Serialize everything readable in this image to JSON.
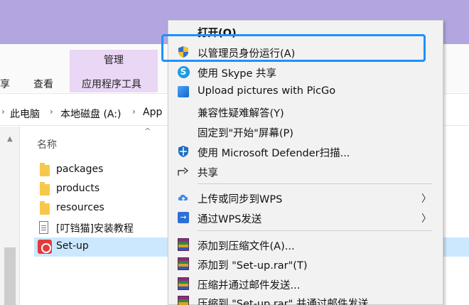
{
  "explorer": {
    "ribbon": {
      "tabs": [
        "享",
        "查看"
      ],
      "contextual_group": "管理",
      "contextual_tab": "应用程序工具"
    },
    "breadcrumb": [
      "此电脑",
      "本地磁盘 (A:)",
      "App"
    ],
    "column_header": "名称",
    "files": [
      {
        "name": "packages",
        "icon": "folder-icon"
      },
      {
        "name": "products",
        "icon": "folder-icon"
      },
      {
        "name": "resources",
        "icon": "folder-icon"
      },
      {
        "name": "[叮铛猫]安装教程",
        "icon": "document-icon"
      },
      {
        "name": "Set-up",
        "icon": "setup-exe-icon",
        "selected": true
      }
    ]
  },
  "context_menu": {
    "items": [
      {
        "label": "打开(O)",
        "bold": true,
        "icon": ""
      },
      {
        "label": "以管理员身份运行(A)",
        "icon": "uac-shield-icon",
        "highlighted": true
      },
      {
        "label": "使用 Skype 共享",
        "icon": "skype-icon"
      },
      {
        "label": "Upload pictures with PicGo",
        "icon": "picgo-icon"
      },
      {
        "label": "兼容性疑难解答(Y)",
        "icon": ""
      },
      {
        "label": "固定到\"开始\"屏幕(P)",
        "icon": ""
      },
      {
        "label": "使用 Microsoft Defender扫描...",
        "icon": "defender-icon"
      },
      {
        "label": "共享",
        "icon": "share-icon"
      },
      {
        "label": "上传或同步到WPS",
        "icon": "wps-cloud-icon",
        "submenu": true
      },
      {
        "label": "通过WPS发送",
        "icon": "wps-send-icon",
        "submenu": true
      },
      {
        "label": "添加到压缩文件(A)...",
        "icon": "winrar-icon"
      },
      {
        "label": "添加到 \"Set-up.rar\"(T)",
        "icon": "winrar-icon"
      },
      {
        "label": "压缩并通过邮件发送...",
        "icon": "winrar-icon"
      },
      {
        "label": "压缩到 \"Set-up.rar\" 并通过邮件发送",
        "icon": "winrar-icon"
      }
    ]
  },
  "colors": {
    "titlebar": "#b3a6e0",
    "contextual_tab": "#ead7f5",
    "selection": "#cce8ff",
    "highlight_outline": "#1e90ff"
  }
}
